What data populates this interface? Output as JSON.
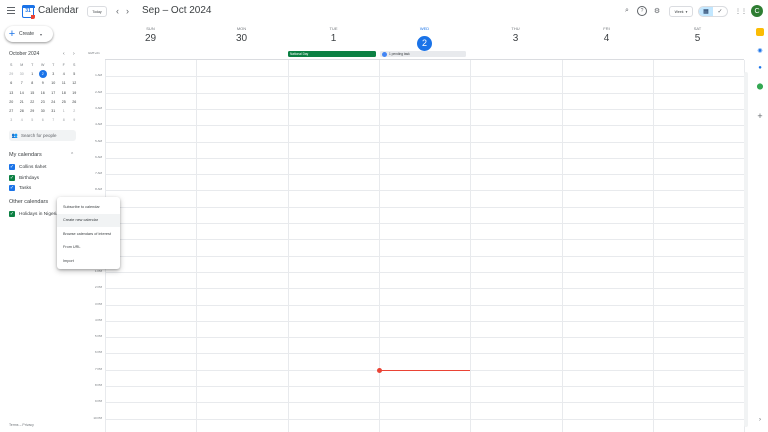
{
  "header": {
    "app_title": "Calendar",
    "logo_day": "31",
    "today_label": "Today",
    "date_range": "Sep – Oct 2024",
    "view_label": "Week",
    "avatar_initial": "C"
  },
  "create": {
    "label": "Create"
  },
  "mini_calendar": {
    "month_label": "October 2024",
    "dow": [
      "S",
      "M",
      "T",
      "W",
      "T",
      "F",
      "S"
    ],
    "weeks": [
      [
        "29",
        "30",
        "1",
        "2",
        "3",
        "4",
        "5"
      ],
      [
        "6",
        "7",
        "8",
        "9",
        "10",
        "11",
        "12"
      ],
      [
        "13",
        "14",
        "15",
        "16",
        "17",
        "18",
        "19"
      ],
      [
        "20",
        "21",
        "22",
        "23",
        "24",
        "25",
        "26"
      ],
      [
        "27",
        "28",
        "29",
        "30",
        "31",
        "1",
        "2"
      ],
      [
        "3",
        "4",
        "5",
        "6",
        "7",
        "8",
        "9"
      ]
    ]
  },
  "search_people": {
    "placeholder": "Search for people"
  },
  "my_calendars": {
    "title": "My calendars",
    "items": [
      {
        "label": "Collins Ilahet",
        "color": "#1a73e8"
      },
      {
        "label": "Birthdays",
        "color": "#0b8043"
      },
      {
        "label": "Tasks",
        "color": "#1a73e8"
      }
    ]
  },
  "other_calendars": {
    "title": "Other calendars",
    "items": [
      {
        "label": "Holidays in Nigeria",
        "color": "#0b8043"
      }
    ]
  },
  "footer": {
    "links": "Terms – Privacy"
  },
  "week": {
    "gmt_label": "GMT+01",
    "days": [
      {
        "dow": "SUN",
        "num": "29"
      },
      {
        "dow": "MON",
        "num": "30"
      },
      {
        "dow": "TUE",
        "num": "1"
      },
      {
        "dow": "WED",
        "num": "2"
      },
      {
        "dow": "THU",
        "num": "3"
      },
      {
        "dow": "FRI",
        "num": "4"
      },
      {
        "dow": "SAT",
        "num": "5"
      }
    ],
    "hours": [
      "1 AM",
      "2 AM",
      "3 AM",
      "4 AM",
      "5 AM",
      "6 AM",
      "7 AM",
      "8 AM",
      "9 AM",
      "10 AM",
      "11 AM",
      "12 PM",
      "1 PM",
      "2 PM",
      "3 PM",
      "4 PM",
      "5 PM",
      "6 PM",
      "7 PM",
      "8 PM",
      "9 PM",
      "10 PM",
      "11 PM"
    ]
  },
  "events": {
    "holiday": "National Day",
    "tasks": "1 pending task"
  },
  "dropdown": {
    "options": [
      "Subscribe to calendar",
      "Create new calendar",
      "Browse calendars of interest",
      "From URL",
      "Import"
    ]
  },
  "icons": {
    "menu": "menu-icon",
    "search": "search-icon",
    "help": "help-icon",
    "settings": "gear-icon",
    "apps": "apps-grid-icon"
  }
}
